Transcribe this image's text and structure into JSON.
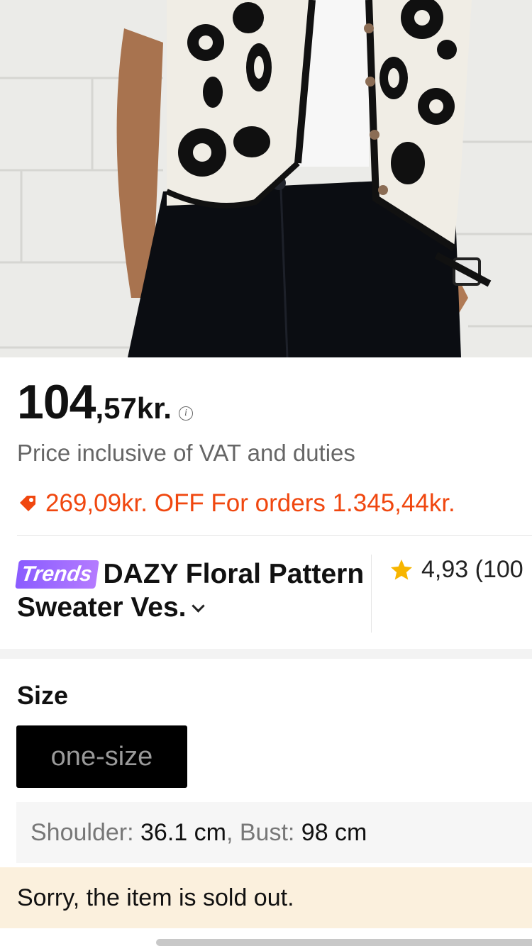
{
  "product": {
    "price_integer": "104",
    "price_decimal": ",57kr.",
    "vat_note": "Price inclusive of VAT and duties",
    "promo_text": "269,09kr. OFF For orders 1.345,44kr.",
    "badge": "Trends",
    "title": "DAZY Floral Pattern Sweater Ves.",
    "rating": "4,93 (100"
  },
  "size": {
    "heading": "Size",
    "selected_option": "one-size",
    "measurements": {
      "shoulder_label": "Shoulder:",
      "shoulder_value": "36.1 cm",
      "separator": ",",
      "bust_label": "Bust:",
      "bust_value": "98 cm"
    }
  },
  "status": {
    "soldout_message": "Sorry, the item is sold out."
  },
  "colors": {
    "promo": "#f0470f",
    "rating_star": "#f7b500",
    "badge": "#8a5cff",
    "soldout_bg": "#fbf0dd"
  }
}
